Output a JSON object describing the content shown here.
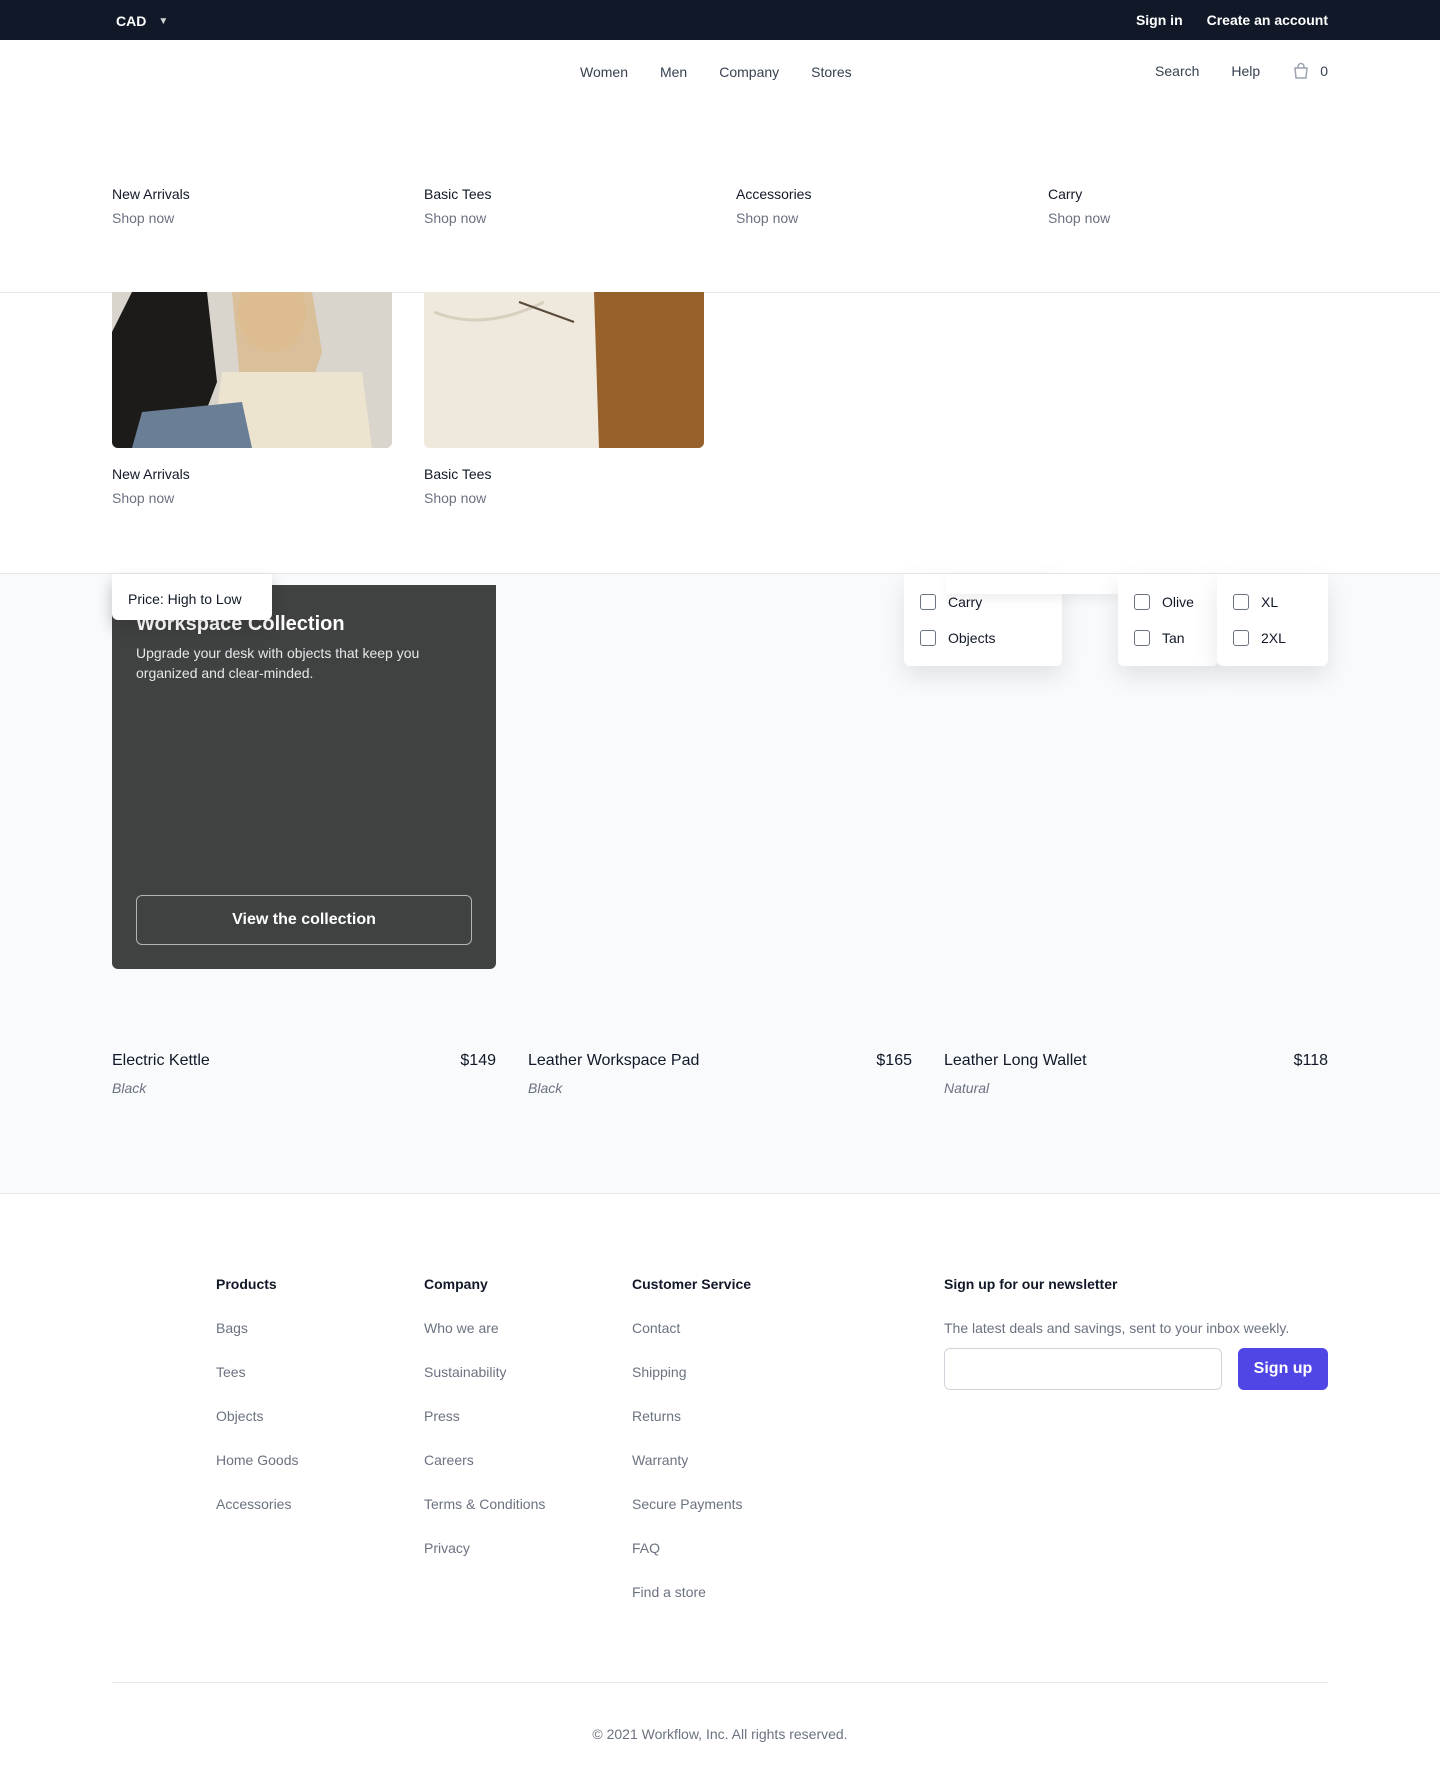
{
  "topbar": {
    "currency": "CAD",
    "sign_in": "Sign in",
    "create_account": "Create an account"
  },
  "nav": {
    "links": [
      "Women",
      "Men",
      "Company",
      "Stores"
    ],
    "search": "Search",
    "help": "Help",
    "cart_count": "0"
  },
  "mega": {
    "row1": [
      {
        "name": "New Arrivals",
        "cta": "Shop now"
      },
      {
        "name": "Basic Tees",
        "cta": "Shop now"
      },
      {
        "name": "Accessories",
        "cta": "Shop now"
      },
      {
        "name": "Carry",
        "cta": "Shop now"
      }
    ],
    "row2": [
      {
        "name": "New Arrivals",
        "cta": "Shop now"
      },
      {
        "name": "Basic Tees",
        "cta": "Shop now"
      }
    ]
  },
  "sort": {
    "option": "Price: High to Low"
  },
  "promo": {
    "title": "Workspace Collection",
    "description": "Upgrade your desk with objects that keep you organized and clear-minded.",
    "button": "View the collection"
  },
  "filters": {
    "category": [
      "Carry",
      "Objects"
    ],
    "color": [
      "Olive",
      "Tan"
    ],
    "size": [
      "XL",
      "2XL"
    ]
  },
  "products": [
    {
      "name": "Electric Kettle",
      "price": "$149",
      "color": "Black"
    },
    {
      "name": "Leather Workspace Pad",
      "price": "$165",
      "color": "Black"
    },
    {
      "name": "Leather Long Wallet",
      "price": "$118",
      "color": "Natural"
    }
  ],
  "footer": {
    "products": {
      "title": "Products",
      "links": [
        "Bags",
        "Tees",
        "Objects",
        "Home Goods",
        "Accessories"
      ]
    },
    "company": {
      "title": "Company",
      "links": [
        "Who we are",
        "Sustainability",
        "Press",
        "Careers",
        "Terms & Conditions",
        "Privacy"
      ]
    },
    "service": {
      "title": "Customer Service",
      "links": [
        "Contact",
        "Shipping",
        "Returns",
        "Warranty",
        "Secure Payments",
        "FAQ",
        "Find a store"
      ]
    },
    "newsletter": {
      "title": "Sign up for our newsletter",
      "description": "The latest deals and savings, sent to your inbox weekly.",
      "button": "Sign up"
    },
    "copyright": "© 2021 Workflow, Inc. All rights reserved."
  },
  "colors": {
    "topbar": "#111827",
    "accent": "#4f46e5",
    "promo_bg": "#3f4240"
  }
}
